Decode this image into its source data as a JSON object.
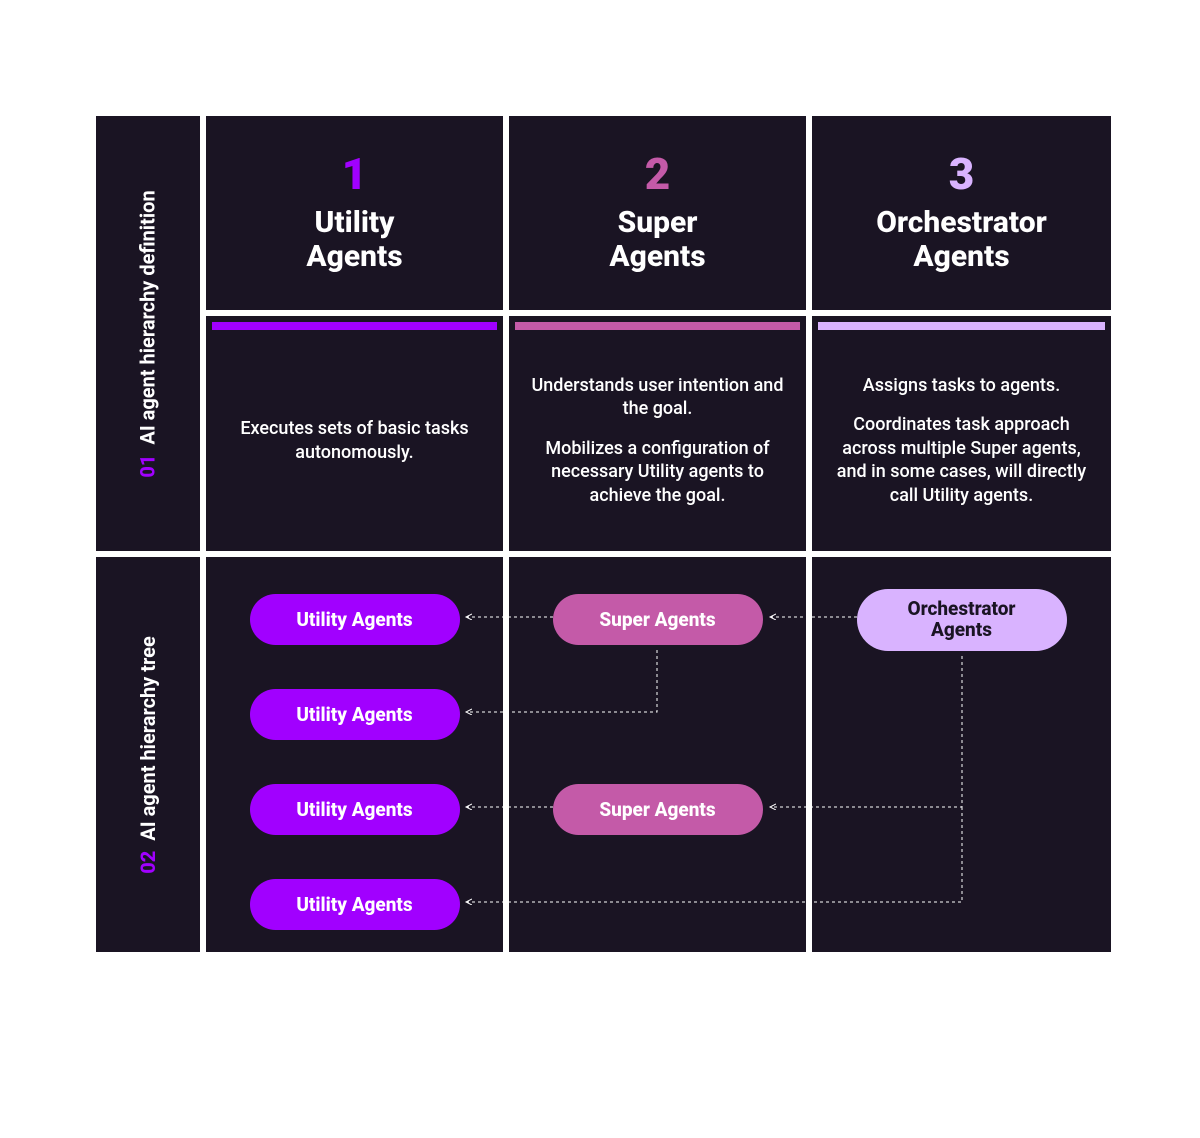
{
  "sections": {
    "row1": {
      "num": "01",
      "label": "AI agent hierarchy definition"
    },
    "row2": {
      "num": "02",
      "label": "AI agent hierarchy tree"
    }
  },
  "columns": [
    {
      "num": "1",
      "title": "Utility\nAgents",
      "color": "#a100ff",
      "desc": [
        "Executes sets of basic tasks autonomously."
      ]
    },
    {
      "num": "2",
      "title": "Super\nAgents",
      "color": "#c45aa8",
      "desc": [
        "Understands user intention and the goal.",
        "Mobilizes a configuration of necessary Utility agents to achieve the goal."
      ]
    },
    {
      "num": "3",
      "title": "Orchestrator\nAgents",
      "color": "#d9b3ff",
      "desc": [
        "Assigns tasks to agents.",
        "Coordinates task approach across multiple Super agents, and in some cases, will directly call Utility agents."
      ]
    }
  ],
  "tree": {
    "utility_label": "Utility Agents",
    "super_label": "Super Agents",
    "orch_label": "Orchestrator Agents",
    "utility_color": "#a100ff",
    "super_color": "#c45aa8",
    "orch_color": "#d9b3ff",
    "utility_text": "#ffffff",
    "super_text": "#ffffff",
    "orch_text": "#1a1423"
  }
}
